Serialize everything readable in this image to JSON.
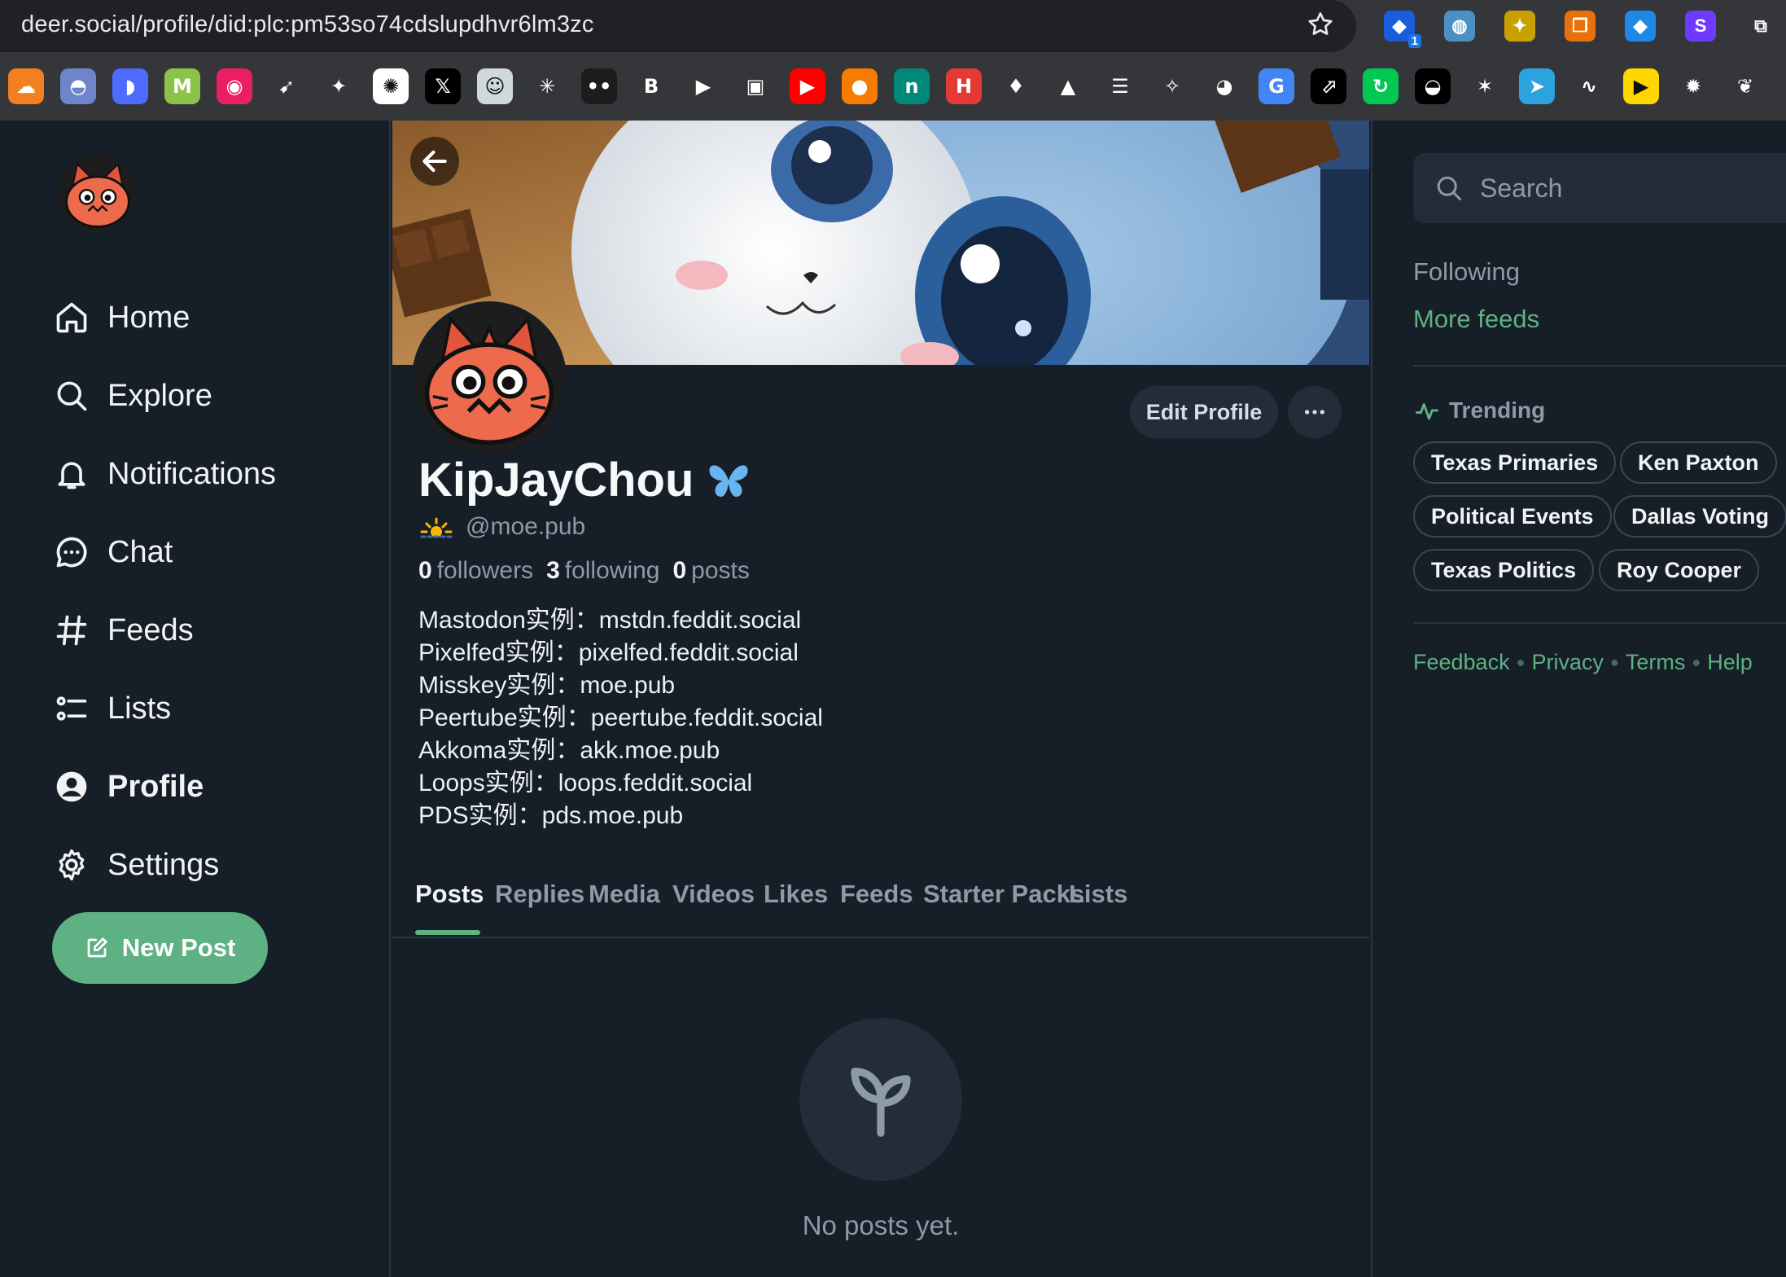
{
  "browser": {
    "url": "deer.social/profile/did:plc:pm53so74cdslupdhvr6lm3zc",
    "extension_badge": "1",
    "extensions": [
      {
        "name": "bitwarden-icon",
        "color": "#175ddc",
        "glyph": "◆"
      },
      {
        "name": "globe-icon",
        "color": "#4a90c2",
        "glyph": "◍"
      },
      {
        "name": "tampermonkey-icon",
        "color": "#c8a000",
        "glyph": "✦"
      },
      {
        "name": "copy-icon",
        "color": "#e8710a",
        "glyph": "❐"
      },
      {
        "name": "gem-icon",
        "color": "#1e88e5",
        "glyph": "◆"
      },
      {
        "name": "s-icon",
        "color": "#6d3aff",
        "glyph": "S"
      },
      {
        "name": "puzzle-icon",
        "color": "#35363a",
        "glyph": "⧉"
      }
    ],
    "bookmarks": [
      {
        "name": "cloudflare-icon",
        "color": "#f38020",
        "glyph": "☁"
      },
      {
        "name": "ghost-icon",
        "color": "#6e86c9",
        "glyph": "◓"
      },
      {
        "name": "deepseek-icon",
        "color": "#4d6bfe",
        "glyph": "◗"
      },
      {
        "name": "mi-icon",
        "color": "#8bc34a",
        "glyph": "M"
      },
      {
        "name": "colorwheel-icon",
        "color": "#e91e63",
        "glyph": "◉"
      },
      {
        "name": "arrow-icon",
        "color": "#35363a",
        "glyph": "➹"
      },
      {
        "name": "gemini-icon",
        "color": "#35363a",
        "glyph": "✦"
      },
      {
        "name": "openai-icon",
        "color": "#ffffff",
        "glyph": "✺"
      },
      {
        "name": "x-icon",
        "color": "#000000",
        "glyph": "𝕏"
      },
      {
        "name": "avatar-bookmark-icon",
        "color": "#cfd8dc",
        "glyph": "☺"
      },
      {
        "name": "claude-icon",
        "color": "#35363a",
        "glyph": "✳"
      },
      {
        "name": "dots-icon",
        "color": "#1c1c1c",
        "glyph": "••"
      },
      {
        "name": "b-icon",
        "color": "#35363a",
        "glyph": "B"
      },
      {
        "name": "play-orange-icon",
        "color": "#35363a",
        "glyph": "▶"
      },
      {
        "name": "bilibili-icon",
        "color": "#35363a",
        "glyph": "▣"
      },
      {
        "name": "youtube-icon",
        "color": "#ff0000",
        "glyph": "▶"
      },
      {
        "name": "jay-icon",
        "color": "#f57c00",
        "glyph": "●"
      },
      {
        "name": "n-icon",
        "color": "#00897b",
        "glyph": "n"
      },
      {
        "name": "h-icon",
        "color": "#e53935",
        "glyph": "H"
      },
      {
        "name": "drop-icon",
        "color": "#35363a",
        "glyph": "♦"
      },
      {
        "name": "triangle-icon",
        "color": "#35363a",
        "glyph": "▲"
      },
      {
        "name": "list-icon",
        "color": "#35363a",
        "glyph": "☰"
      },
      {
        "name": "bluesky-sparkle-icon",
        "color": "#35363a",
        "glyph": "✧"
      },
      {
        "name": "github-icon",
        "color": "#35363a",
        "glyph": "◕"
      },
      {
        "name": "translate-icon",
        "color": "#4285f4",
        "glyph": "G"
      },
      {
        "name": "external-icon",
        "color": "#000000",
        "glyph": "⬀"
      },
      {
        "name": "refresh-icon",
        "color": "#00c853",
        "glyph": "↻"
      },
      {
        "name": "bird-icon",
        "color": "#000000",
        "glyph": "◒"
      },
      {
        "name": "party-icon",
        "color": "#35363a",
        "glyph": "✶"
      },
      {
        "name": "telegram-icon",
        "color": "#2aa3df",
        "glyph": "➤"
      },
      {
        "name": "wave-icon",
        "color": "#35363a",
        "glyph": "∿"
      },
      {
        "name": "play-yellow-icon",
        "color": "#ffd600",
        "glyph": "▶"
      },
      {
        "name": "gear-orange-icon",
        "color": "#35363a",
        "glyph": "✹"
      },
      {
        "name": "leaf-icon",
        "color": "#35363a",
        "glyph": "❦"
      }
    ]
  },
  "nav": {
    "home": "Home",
    "explore": "Explore",
    "notifications": "Notifications",
    "chat": "Chat",
    "feeds": "Feeds",
    "lists": "Lists",
    "profile": "Profile",
    "settings": "Settings",
    "new_post": "New Post"
  },
  "profile": {
    "display_name": "KipJayChou",
    "handle": "@moe.pub",
    "followers_count": "0",
    "followers_label": "followers",
    "following_count": "3",
    "following_label": "following",
    "posts_count": "0",
    "posts_label": "posts",
    "edit_profile": "Edit Profile",
    "bio": [
      "Mastodon实例：mstdn.feddit.social",
      "Pixelfed实例：pixelfed.feddit.social",
      "Misskey实例：moe.pub",
      "Peertube实例：peertube.feddit.social",
      "Akkoma实例：akk.moe.pub",
      "Loops实例：loops.feddit.social",
      "PDS实例：pds.moe.pub"
    ]
  },
  "tabs": [
    "Posts",
    "Replies",
    "Media",
    "Videos",
    "Likes",
    "Feeds",
    "Starter Packs",
    "Lists"
  ],
  "active_tab": "Posts",
  "empty_state": "No posts yet.",
  "sidebar": {
    "search_placeholder": "Search",
    "following": "Following",
    "more_feeds": "More feeds",
    "trending_label": "Trending",
    "trending": [
      "Texas Primaries",
      "Ken Paxton",
      "Political Events",
      "Dallas Voting",
      "Texas Politics",
      "Roy Cooper"
    ],
    "footer": [
      "Feedback",
      "Privacy",
      "Terms",
      "Help"
    ]
  },
  "colors": {
    "background": "#161e27",
    "accent": "#5eb183",
    "muted_text": "#8e9aa8",
    "panel": "#222d39"
  }
}
